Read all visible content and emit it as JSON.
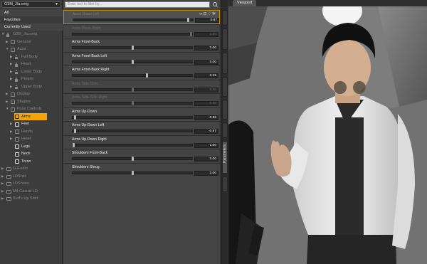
{
  "tree_panel": {
    "dropdown": "G3M_Jia.omg",
    "filters": [
      "All",
      "Favorites",
      "Currently Used"
    ],
    "nodes": [
      {
        "label": "G3M_Jia.omg",
        "depth": 0,
        "icon": "figure-icon",
        "expander": "down",
        "state": "dim"
      },
      {
        "label": "General",
        "depth": 1,
        "icon": "parameter-box-icon",
        "expander": "right",
        "state": "dim"
      },
      {
        "label": "Actor",
        "depth": 1,
        "icon": "parameter-box-icon",
        "expander": "down",
        "state": "dim"
      },
      {
        "label": "Full Body",
        "depth": 2,
        "icon": "figure-icon",
        "expander": "right",
        "state": "dim"
      },
      {
        "label": "Head",
        "depth": 2,
        "icon": "figure-icon",
        "expander": "right",
        "state": "dim"
      },
      {
        "label": "Lower Body",
        "depth": 2,
        "icon": "figure-icon",
        "expander": "right",
        "state": "dim"
      },
      {
        "label": "People",
        "depth": 2,
        "icon": "figure-icon",
        "expander": "right",
        "state": "dim"
      },
      {
        "label": "Upper Body",
        "depth": 2,
        "icon": "figure-icon",
        "expander": "right",
        "state": "dim"
      },
      {
        "label": "Display",
        "depth": 1,
        "icon": "parameter-box-icon",
        "expander": "right",
        "state": "dim"
      },
      {
        "label": "Shapes",
        "depth": 1,
        "icon": "parameter-box-icon",
        "expander": "right",
        "state": "dim"
      },
      {
        "label": "Pose Controls",
        "depth": 1,
        "icon": "parameter-box-icon",
        "expander": "down",
        "state": "dim"
      },
      {
        "label": "Arms",
        "depth": 2,
        "icon": "parameter-box-icon",
        "expander": "",
        "state": "selected"
      },
      {
        "label": "Feet",
        "depth": 2,
        "icon": "parameter-box-icon",
        "expander": "right",
        "state": "bright"
      },
      {
        "label": "Hands",
        "depth": 2,
        "icon": "parameter-box-icon",
        "expander": "right",
        "state": "dim"
      },
      {
        "label": "Head",
        "depth": 2,
        "icon": "parameter-box-icon",
        "expander": "right",
        "state": "dim"
      },
      {
        "label": "Legs",
        "depth": 2,
        "icon": "parameter-box-icon",
        "expander": "",
        "state": "bright"
      },
      {
        "label": "Neck",
        "depth": 2,
        "icon": "parameter-box-icon",
        "expander": "",
        "state": "bright"
      },
      {
        "label": "Torso",
        "depth": 2,
        "icon": "parameter-box-icon",
        "expander": "",
        "state": "bright"
      },
      {
        "label": "GJFedio",
        "depth": 0,
        "icon": "folder-icon",
        "expander": "right",
        "state": "dim"
      },
      {
        "label": "LDShirt",
        "depth": 0,
        "icon": "folder-icon",
        "expander": "right",
        "state": "dim"
      },
      {
        "label": "LDShoes",
        "depth": 0,
        "icon": "folder-icon",
        "expander": "right",
        "state": "dim"
      },
      {
        "label": "M4 Casual LD",
        "depth": 0,
        "icon": "folder-icon",
        "expander": "right",
        "state": "dim"
      },
      {
        "label": "Surf's Up Shirt",
        "depth": 0,
        "icon": "folder-icon",
        "expander": "right",
        "state": "dim"
      }
    ]
  },
  "slider_panel": {
    "search_placeholder": "Enter text to filter by...",
    "params": [
      {
        "name": "Arms Down-Left",
        "value": "0.97",
        "pos": 0.97,
        "state": "first"
      },
      {
        "name": "Arms Down-Right",
        "value": "1.00",
        "pos": 1.0,
        "state": "dim"
      },
      {
        "name": "Arms Front-Back",
        "value": "0.00",
        "pos": 0.5,
        "state": "normal"
      },
      {
        "name": "Arms Front-Back Left",
        "value": "0.00",
        "pos": 0.5,
        "state": "normal"
      },
      {
        "name": "Arms Front-Back Right",
        "value": "0.25",
        "pos": 0.625,
        "state": "normal"
      },
      {
        "name": "Arms Side-Side",
        "value": "0.00",
        "pos": 0.5,
        "state": "dim"
      },
      {
        "name": "Arms Side-Side Right",
        "value": "0.00",
        "pos": 0.5,
        "state": "dim"
      },
      {
        "name": "Arms Up-Down",
        "value": "-0.98",
        "pos": 0.01,
        "state": "normal"
      },
      {
        "name": "Arms Up-Down Left",
        "value": "-0.97",
        "pos": 0.015,
        "state": "normal"
      },
      {
        "name": "Arms Up-Down Right",
        "value": "-1.00",
        "pos": 0.0,
        "state": "normal"
      },
      {
        "name": "Shoulders Front-Back",
        "value": "0.00",
        "pos": 0.5,
        "state": "normal"
      },
      {
        "name": "Shoulders Shrug",
        "value": "0.00",
        "pos": 0.5,
        "state": "normal"
      }
    ],
    "row_action_icons": [
      "link-icon",
      "lock-icon",
      "heart-icon",
      "gear-icon"
    ]
  },
  "side_strip": {
    "tab_label": "Parameters"
  },
  "viewport": {
    "tab_label": "Viewport"
  }
}
